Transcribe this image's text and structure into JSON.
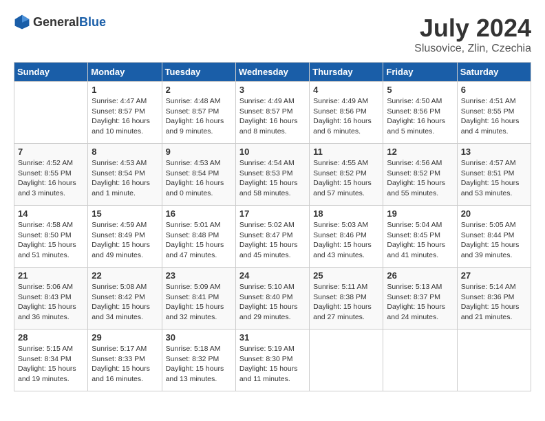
{
  "header": {
    "logo_general": "General",
    "logo_blue": "Blue",
    "title": "July 2024",
    "location": "Slusovice, Zlin, Czechia"
  },
  "days_of_week": [
    "Sunday",
    "Monday",
    "Tuesday",
    "Wednesday",
    "Thursday",
    "Friday",
    "Saturday"
  ],
  "weeks": [
    [
      {
        "day": "",
        "info": ""
      },
      {
        "day": "1",
        "info": "Sunrise: 4:47 AM\nSunset: 8:57 PM\nDaylight: 16 hours\nand 10 minutes."
      },
      {
        "day": "2",
        "info": "Sunrise: 4:48 AM\nSunset: 8:57 PM\nDaylight: 16 hours\nand 9 minutes."
      },
      {
        "day": "3",
        "info": "Sunrise: 4:49 AM\nSunset: 8:57 PM\nDaylight: 16 hours\nand 8 minutes."
      },
      {
        "day": "4",
        "info": "Sunrise: 4:49 AM\nSunset: 8:56 PM\nDaylight: 16 hours\nand 6 minutes."
      },
      {
        "day": "5",
        "info": "Sunrise: 4:50 AM\nSunset: 8:56 PM\nDaylight: 16 hours\nand 5 minutes."
      },
      {
        "day": "6",
        "info": "Sunrise: 4:51 AM\nSunset: 8:55 PM\nDaylight: 16 hours\nand 4 minutes."
      }
    ],
    [
      {
        "day": "7",
        "info": "Sunrise: 4:52 AM\nSunset: 8:55 PM\nDaylight: 16 hours\nand 3 minutes."
      },
      {
        "day": "8",
        "info": "Sunrise: 4:53 AM\nSunset: 8:54 PM\nDaylight: 16 hours\nand 1 minute."
      },
      {
        "day": "9",
        "info": "Sunrise: 4:53 AM\nSunset: 8:54 PM\nDaylight: 16 hours\nand 0 minutes."
      },
      {
        "day": "10",
        "info": "Sunrise: 4:54 AM\nSunset: 8:53 PM\nDaylight: 15 hours\nand 58 minutes."
      },
      {
        "day": "11",
        "info": "Sunrise: 4:55 AM\nSunset: 8:52 PM\nDaylight: 15 hours\nand 57 minutes."
      },
      {
        "day": "12",
        "info": "Sunrise: 4:56 AM\nSunset: 8:52 PM\nDaylight: 15 hours\nand 55 minutes."
      },
      {
        "day": "13",
        "info": "Sunrise: 4:57 AM\nSunset: 8:51 PM\nDaylight: 15 hours\nand 53 minutes."
      }
    ],
    [
      {
        "day": "14",
        "info": "Sunrise: 4:58 AM\nSunset: 8:50 PM\nDaylight: 15 hours\nand 51 minutes."
      },
      {
        "day": "15",
        "info": "Sunrise: 4:59 AM\nSunset: 8:49 PM\nDaylight: 15 hours\nand 49 minutes."
      },
      {
        "day": "16",
        "info": "Sunrise: 5:01 AM\nSunset: 8:48 PM\nDaylight: 15 hours\nand 47 minutes."
      },
      {
        "day": "17",
        "info": "Sunrise: 5:02 AM\nSunset: 8:47 PM\nDaylight: 15 hours\nand 45 minutes."
      },
      {
        "day": "18",
        "info": "Sunrise: 5:03 AM\nSunset: 8:46 PM\nDaylight: 15 hours\nand 43 minutes."
      },
      {
        "day": "19",
        "info": "Sunrise: 5:04 AM\nSunset: 8:45 PM\nDaylight: 15 hours\nand 41 minutes."
      },
      {
        "day": "20",
        "info": "Sunrise: 5:05 AM\nSunset: 8:44 PM\nDaylight: 15 hours\nand 39 minutes."
      }
    ],
    [
      {
        "day": "21",
        "info": "Sunrise: 5:06 AM\nSunset: 8:43 PM\nDaylight: 15 hours\nand 36 minutes."
      },
      {
        "day": "22",
        "info": "Sunrise: 5:08 AM\nSunset: 8:42 PM\nDaylight: 15 hours\nand 34 minutes."
      },
      {
        "day": "23",
        "info": "Sunrise: 5:09 AM\nSunset: 8:41 PM\nDaylight: 15 hours\nand 32 minutes."
      },
      {
        "day": "24",
        "info": "Sunrise: 5:10 AM\nSunset: 8:40 PM\nDaylight: 15 hours\nand 29 minutes."
      },
      {
        "day": "25",
        "info": "Sunrise: 5:11 AM\nSunset: 8:38 PM\nDaylight: 15 hours\nand 27 minutes."
      },
      {
        "day": "26",
        "info": "Sunrise: 5:13 AM\nSunset: 8:37 PM\nDaylight: 15 hours\nand 24 minutes."
      },
      {
        "day": "27",
        "info": "Sunrise: 5:14 AM\nSunset: 8:36 PM\nDaylight: 15 hours\nand 21 minutes."
      }
    ],
    [
      {
        "day": "28",
        "info": "Sunrise: 5:15 AM\nSunset: 8:34 PM\nDaylight: 15 hours\nand 19 minutes."
      },
      {
        "day": "29",
        "info": "Sunrise: 5:17 AM\nSunset: 8:33 PM\nDaylight: 15 hours\nand 16 minutes."
      },
      {
        "day": "30",
        "info": "Sunrise: 5:18 AM\nSunset: 8:32 PM\nDaylight: 15 hours\nand 13 minutes."
      },
      {
        "day": "31",
        "info": "Sunrise: 5:19 AM\nSunset: 8:30 PM\nDaylight: 15 hours\nand 11 minutes."
      },
      {
        "day": "",
        "info": ""
      },
      {
        "day": "",
        "info": ""
      },
      {
        "day": "",
        "info": ""
      }
    ]
  ]
}
